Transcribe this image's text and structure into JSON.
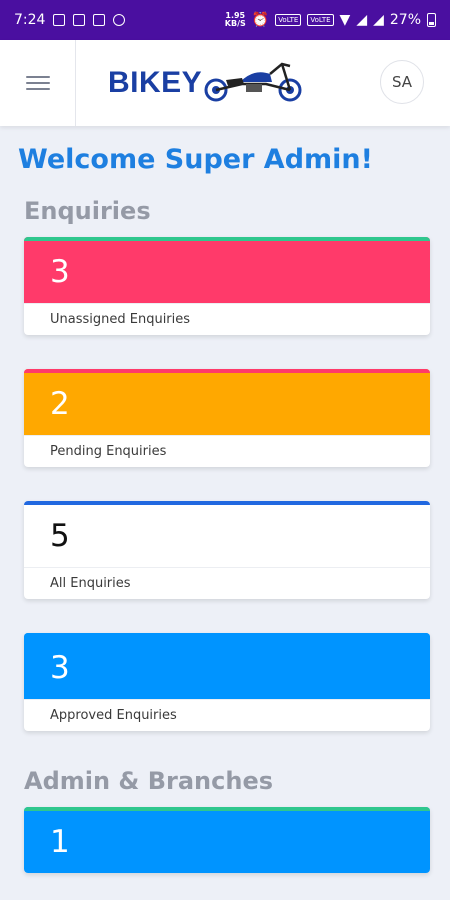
{
  "status_bar": {
    "time": "7:24",
    "speed_value": "1.95",
    "speed_unit": "KB/S",
    "lte1": "VoLTE",
    "lte2": "VoLTE",
    "battery": "27%"
  },
  "header": {
    "logo_text": "BIKEY",
    "avatar_initials": "SA"
  },
  "welcome_text": "Welcome Super Admin!",
  "sections": {
    "enquiries": {
      "title": "Enquiries",
      "cards": [
        {
          "value": "3",
          "label": "Unassigned Enquiries",
          "color": "#ff3a6a"
        },
        {
          "value": "2",
          "label": "Pending Enquiries",
          "color": "#ffa800"
        },
        {
          "value": "5",
          "label": "All Enquiries",
          "color": "#ffffff"
        },
        {
          "value": "3",
          "label": "Approved Enquiries",
          "color": "#0094ff"
        }
      ]
    },
    "admin_branches": {
      "title": "Admin & Branches",
      "cards": [
        {
          "value": "1",
          "color": "#0094ff"
        }
      ]
    }
  },
  "colors": {
    "status_bar": "#4a0fa0",
    "welcome": "#1e7fe0",
    "logo": "#1a3fa3",
    "accent_green": "#2fc78e"
  }
}
